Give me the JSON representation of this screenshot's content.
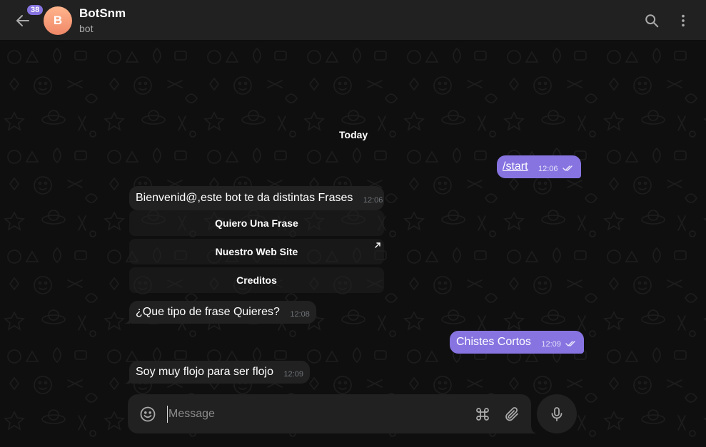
{
  "header": {
    "unread_count": "38",
    "avatar_letter": "B",
    "title": "BotSnm",
    "subtitle": "bot",
    "icons": {
      "back": "arrow-left-icon",
      "search": "search-icon",
      "menu": "more-vertical-icon"
    }
  },
  "chat": {
    "date_label": "Today",
    "messages": [
      {
        "direction": "out",
        "text": "/start",
        "time": "12:06",
        "status": "read"
      },
      {
        "direction": "in",
        "text": "Bienvenid@,este bot te da distintas Frases",
        "time": "12:06"
      },
      {
        "direction": "in",
        "text": "¿Que tipo de frase Quieres?",
        "time": "12:08"
      },
      {
        "direction": "out",
        "text": "Chistes Cortos",
        "time": "12:09",
        "status": "read"
      },
      {
        "direction": "in",
        "text": "Soy muy flojo para ser flojo",
        "time": "12:09"
      }
    ],
    "inline_keyboard": [
      {
        "label": "Quiero Una Frase"
      },
      {
        "label": "Nuestro Web Site",
        "icon": "external-link-icon"
      },
      {
        "label": "Creditos"
      }
    ]
  },
  "composer": {
    "placeholder": "Message",
    "value": "",
    "icons": {
      "emoji": "smile-icon",
      "commands": "command-icon",
      "attach": "paperclip-icon",
      "voice": "microphone-icon"
    }
  },
  "colors": {
    "accent": "#8774e1",
    "header_bg": "#212121",
    "chat_bg": "#0f0f0f",
    "bubble_in": "#212121",
    "bubble_out": "#8774e1"
  }
}
